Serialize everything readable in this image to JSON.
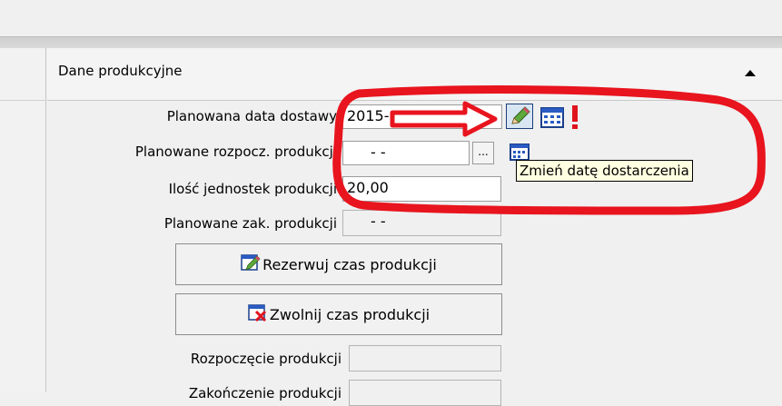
{
  "section": {
    "title": "Dane produkcyjne"
  },
  "fields": {
    "planned_delivery": {
      "label": "Planowana data dostawy",
      "value": "2015-01-12"
    },
    "planned_start": {
      "label": "Planowane rozpocz. produkcji",
      "value": "- -",
      "browse_label": "..."
    },
    "units": {
      "label": "Ilość jednostek produkcji",
      "value": "20,00"
    },
    "planned_end": {
      "label": "Planowane zak. produkcji",
      "value": "- -"
    },
    "start": {
      "label": "Rozpoczęcie produkcji",
      "value": ""
    },
    "end": {
      "label": "Zakończenie produkcji",
      "value": ""
    }
  },
  "buttons": {
    "reserve": "Rezerwuj czas produkcji",
    "release": "Zwolnij czas produkcji"
  },
  "tooltip": "Zmień datę dostarczenia",
  "icons": [
    "pencil-icon",
    "calendar-icon",
    "exclamation-icon",
    "calendar-small-icon",
    "reserve-icon",
    "release-icon",
    "collapse-arrow-icon"
  ],
  "colors": {
    "annotation_red": "#e8141e",
    "tooltip_bg": "#ffffe1"
  }
}
